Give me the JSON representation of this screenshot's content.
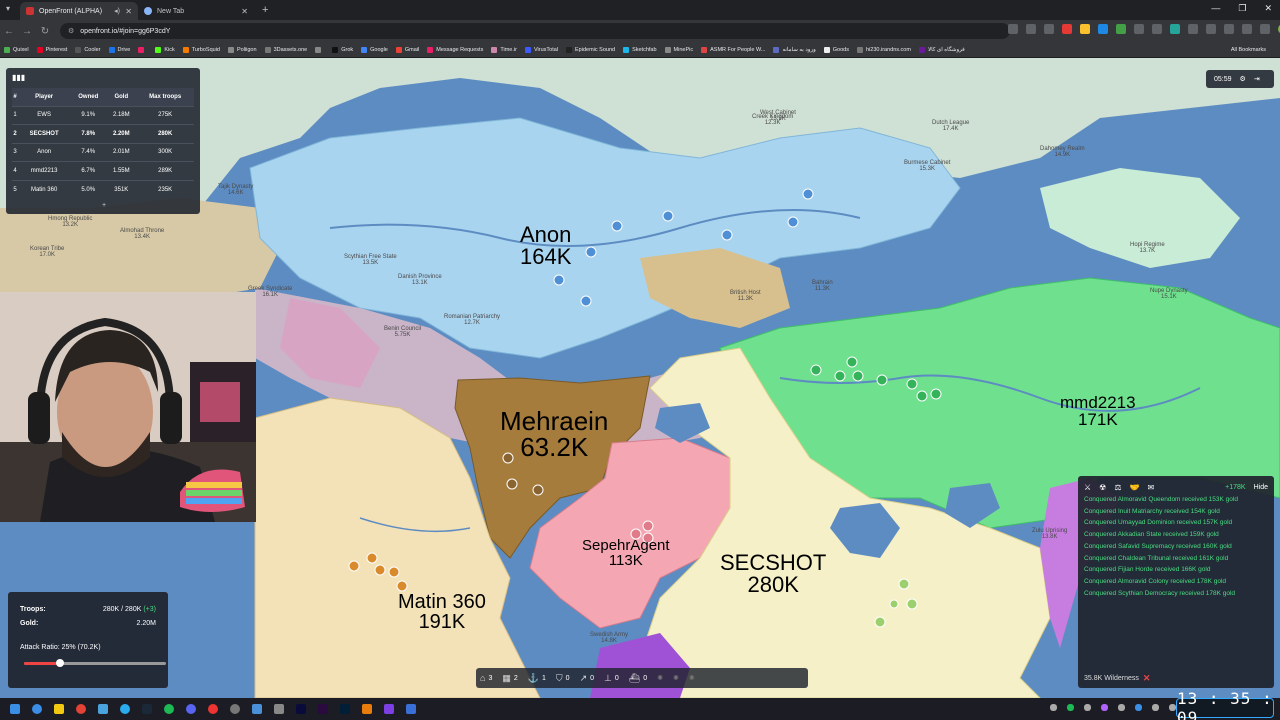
{
  "browser": {
    "tabs": [
      {
        "title": "OpenFront (ALPHA)",
        "active": true
      },
      {
        "title": "New Tab",
        "active": false
      }
    ],
    "url": "openfront.io/#join=gg6P3cdY",
    "bookmarks": [
      "Quixel",
      "Pinterest",
      "Cooler",
      "Drive",
      "",
      "Kick",
      "TurboSquid",
      "Poliigon",
      "3Dassets.one",
      "",
      "Grok",
      "Google",
      "Gmail",
      "Message Requests",
      "Time.ir",
      "VirusTotal",
      "Epidemic Sound",
      "Sketchfab",
      "MinePic",
      "ASMR For People W...",
      "ورود به سامانه",
      "Goods",
      "hi230.irandns.com",
      "فروشگاه ای کالا"
    ],
    "all_bookmarks": "All Bookmarks"
  },
  "leaderboard": {
    "headers": [
      "#",
      "Player",
      "Owned",
      "Gold",
      "Max troops"
    ],
    "rows": [
      {
        "rank": "1",
        "player": "EWS",
        "owned": "9.1%",
        "gold": "2.18M",
        "troops": "275K"
      },
      {
        "rank": "2",
        "player": "SECSHOT",
        "owned": "7.8%",
        "gold": "2.20M",
        "troops": "280K"
      },
      {
        "rank": "3",
        "player": "Anon",
        "owned": "7.4%",
        "gold": "2.01M",
        "troops": "300K"
      },
      {
        "rank": "4",
        "player": "mmd2213",
        "owned": "6.7%",
        "gold": "1.55M",
        "troops": "289K"
      },
      {
        "rank": "5",
        "player": "Matin 360",
        "owned": "5.0%",
        "gold": "351K",
        "troops": "235K"
      }
    ],
    "expand": "+"
  },
  "timer": {
    "time": "05:59"
  },
  "map": {
    "players": [
      {
        "name": "Anon",
        "troops": "164K"
      },
      {
        "name": "Mehraein",
        "troops": "63.2K"
      },
      {
        "name": "mmd2213",
        "troops": "171K"
      },
      {
        "name": "SepehrAgent",
        "troops": "113K"
      },
      {
        "name": "SECSHOT",
        "troops": "280K"
      },
      {
        "name": "Matin 360",
        "troops": "191K"
      }
    ],
    "small_labels": [
      {
        "name": "Tajik Dynasty",
        "val": "14.6K"
      },
      {
        "name": "Hmong Republic",
        "val": "13.2K"
      },
      {
        "name": "Almohad Throne",
        "val": "13.4K"
      },
      {
        "name": "Korean Tribe",
        "val": "17.0K"
      },
      {
        "name": "Scythian Free State",
        "val": "13.5K"
      },
      {
        "name": "Danish Province",
        "val": "13.1K"
      },
      {
        "name": "Greek Syndicate",
        "val": "16.1K"
      },
      {
        "name": "Romanian Patriarchy",
        "val": "12.7K"
      },
      {
        "name": "Benin Council",
        "val": "5.75K"
      },
      {
        "name": "British Host",
        "val": "11.3K"
      },
      {
        "name": "Dutch League",
        "val": "17.4K"
      },
      {
        "name": "Hopi Regime",
        "val": "13.7K"
      },
      {
        "name": "Creek Kingdom",
        "val": "12.3K"
      },
      {
        "name": "Burmese Cabinet",
        "val": "15.3K"
      },
      {
        "name": "Dahomey Realm",
        "val": "14.9K"
      },
      {
        "name": "Bahrain",
        "val": "11.3K"
      },
      {
        "name": "Zulu Uprising",
        "val": "13.8K"
      },
      {
        "name": "West Cabinet",
        "val": "13.9K"
      },
      {
        "name": "Nupe Dynasty",
        "val": "15.1K"
      },
      {
        "name": "Swedish Army",
        "val": "14.8K"
      }
    ]
  },
  "stats": {
    "troops_label": "Troops:",
    "troops_value": "280K / 280K",
    "troops_gain": "(+3)",
    "gold_label": "Gold:",
    "gold_value": "2.20M",
    "attack_ratio": "Attack Ratio: 25% (70.2K)",
    "attack_ratio_fraction": 0.25
  },
  "controls": [
    {
      "icon": "city-icon",
      "value": "3"
    },
    {
      "icon": "factory-icon",
      "value": "2"
    },
    {
      "icon": "port-icon",
      "value": "1"
    },
    {
      "icon": "defense-icon",
      "value": "0"
    },
    {
      "icon": "missile-icon",
      "value": "0"
    },
    {
      "icon": "sam-icon",
      "value": "0"
    },
    {
      "icon": "warship-icon",
      "value": "0"
    }
  ],
  "events": {
    "gold_gain": "+178K",
    "hide": "Hide",
    "items": [
      "Conquered Almoravid Queendom received 153K gold",
      "Conquered Inuit Matriarchy received 154K gold",
      "Conquered Umayyad Dominion received 157K gold",
      "Conquered Akkadian State received 159K gold",
      "Conquered Safavid Supremacy received 160K gold",
      "Conquered Chaldean Tribunal received 161K gold",
      "Conquered Fijian Horde received 166K gold",
      "Conquered Almoravid Colony received 178K gold",
      "Conquered Scythian Democracy received 178K gold"
    ],
    "footer": "35.8K Wilderness"
  },
  "clock": "13 : 35 : 09",
  "colors": {
    "ocean": "#5d8cc2",
    "anon": "#a9d4ef",
    "mehraein": "#a67c3d",
    "mmd2213": "#6fe08e",
    "sepehr": "#f4a7b3",
    "secshot": "#f5f0c8",
    "matin": "#f3e1b8",
    "event_green": "#4ade80"
  }
}
